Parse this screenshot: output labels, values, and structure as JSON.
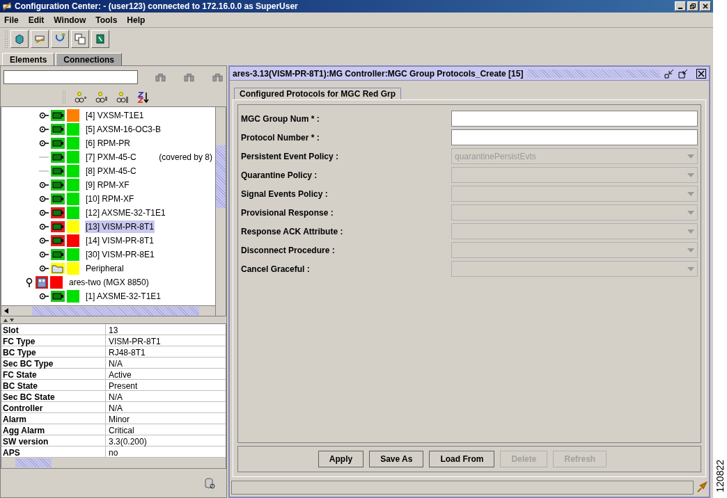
{
  "window": {
    "title": "Configuration Center: - (user123) connected to 172.16.0.0 as SuperUser"
  },
  "menu": [
    "File",
    "Edit",
    "Window",
    "Tools",
    "Help"
  ],
  "tabs": [
    {
      "label": "Elements",
      "selected": true
    },
    {
      "label": "Connections",
      "selected": false
    }
  ],
  "tree": {
    "nodes": [
      {
        "kind": "card",
        "label": "[4] VXSM-T1E1",
        "color": "#ff8000",
        "card_alarm": false,
        "expandable": true,
        "selected": false
      },
      {
        "kind": "card",
        "label": "[5] AXSM-16-OC3-B",
        "color": "#00e000",
        "card_alarm": false,
        "expandable": true,
        "selected": false
      },
      {
        "kind": "card",
        "label": "[6] RPM-PR",
        "color": "#00e000",
        "card_alarm": false,
        "expandable": true,
        "selected": false
      },
      {
        "kind": "card",
        "label": "[7] PXM-45-C",
        "note": "(covered by 8)",
        "color": "#00e000",
        "card_alarm": false,
        "expandable": false,
        "selected": false
      },
      {
        "kind": "card",
        "label": "[8] PXM-45-C",
        "color": "#00e000",
        "card_alarm": false,
        "expandable": false,
        "selected": false
      },
      {
        "kind": "card",
        "label": "[9] RPM-XF",
        "color": "#00e000",
        "card_alarm": false,
        "expandable": true,
        "selected": false
      },
      {
        "kind": "card",
        "label": "[10] RPM-XF",
        "color": "#00e000",
        "card_alarm": false,
        "expandable": true,
        "selected": false
      },
      {
        "kind": "card",
        "label": "[12] AXSME-32-T1E1",
        "color": "#00e000",
        "card_alarm": true,
        "expandable": true,
        "selected": false
      },
      {
        "kind": "card",
        "label": "[13] VISM-PR-8T1",
        "color": "#ffff00",
        "card_alarm": true,
        "expandable": true,
        "selected": true
      },
      {
        "kind": "card",
        "label": "[14] VISM-PR-8T1",
        "color": "#ff0000",
        "card_alarm": true,
        "expandable": true,
        "selected": false
      },
      {
        "kind": "card",
        "label": "[30] VISM-PR-8E1",
        "color": "#00e000",
        "card_alarm": false,
        "expandable": true,
        "selected": false
      },
      {
        "kind": "folder",
        "label": "Peripheral",
        "color": "#ffff00",
        "expandable": true,
        "selected": false
      },
      {
        "kind": "shelf",
        "label": "ares-two (MGX 8850)",
        "color": "#ff0000",
        "expanded": true,
        "selected": false,
        "children": [
          {
            "kind": "card",
            "label": "[1] AXSME-32-T1E1",
            "color": "#00e000",
            "card_alarm": false,
            "expandable": true,
            "selected": false
          }
        ]
      }
    ]
  },
  "properties": [
    {
      "name": "Slot",
      "value": "13"
    },
    {
      "name": "FC Type",
      "value": "VISM-PR-8T1"
    },
    {
      "name": "BC Type",
      "value": "RJ48-8T1"
    },
    {
      "name": "Sec BC Type",
      "value": "N/A"
    },
    {
      "name": "FC State",
      "value": "Active"
    },
    {
      "name": "BC State",
      "value": "Present"
    },
    {
      "name": "Sec BC State",
      "value": "N/A"
    },
    {
      "name": "Controller",
      "value": "N/A"
    },
    {
      "name": "Alarm",
      "value": "Minor"
    },
    {
      "name": "Agg Alarm",
      "value": "Critical"
    },
    {
      "name": "SW version",
      "value": "3.3(0.200)"
    },
    {
      "name": "APS",
      "value": "no"
    }
  ],
  "frame": {
    "title": "ares-3.13(VISM-PR-8T1):MG Controller:MGC Group Protocols_Create [15]",
    "tab": {
      "label": "Configured Protocols for MGC Red Grp",
      "selected": true
    },
    "fields": [
      {
        "label": "MGC Group Num * :",
        "kind": "text",
        "disabled": false
      },
      {
        "label": "Protocol Number * :",
        "kind": "text",
        "disabled": false
      },
      {
        "label": "Persistent Event Policy :",
        "kind": "select",
        "value": "quarantinePersistEvts",
        "disabled": true
      },
      {
        "label": "Quarantine Policy :",
        "kind": "select",
        "disabled": true
      },
      {
        "label": "Signal Events Policy :",
        "kind": "select",
        "disabled": true
      },
      {
        "label": "Provisional Response :",
        "kind": "select",
        "disabled": true
      },
      {
        "label": "Response ACK Attribute :",
        "kind": "select",
        "disabled": true
      },
      {
        "label": "Disconnect Procedure :",
        "kind": "select",
        "disabled": true
      },
      {
        "label": "Cancel Graceful :",
        "kind": "select",
        "disabled": true
      }
    ],
    "buttons": [
      {
        "label": "Apply",
        "disabled": false
      },
      {
        "label": "Save As",
        "disabled": false
      },
      {
        "label": "Load From",
        "disabled": false
      },
      {
        "label": "Delete",
        "disabled": true
      },
      {
        "label": "Refresh",
        "disabled": true
      }
    ]
  },
  "figure_number": "120822"
}
